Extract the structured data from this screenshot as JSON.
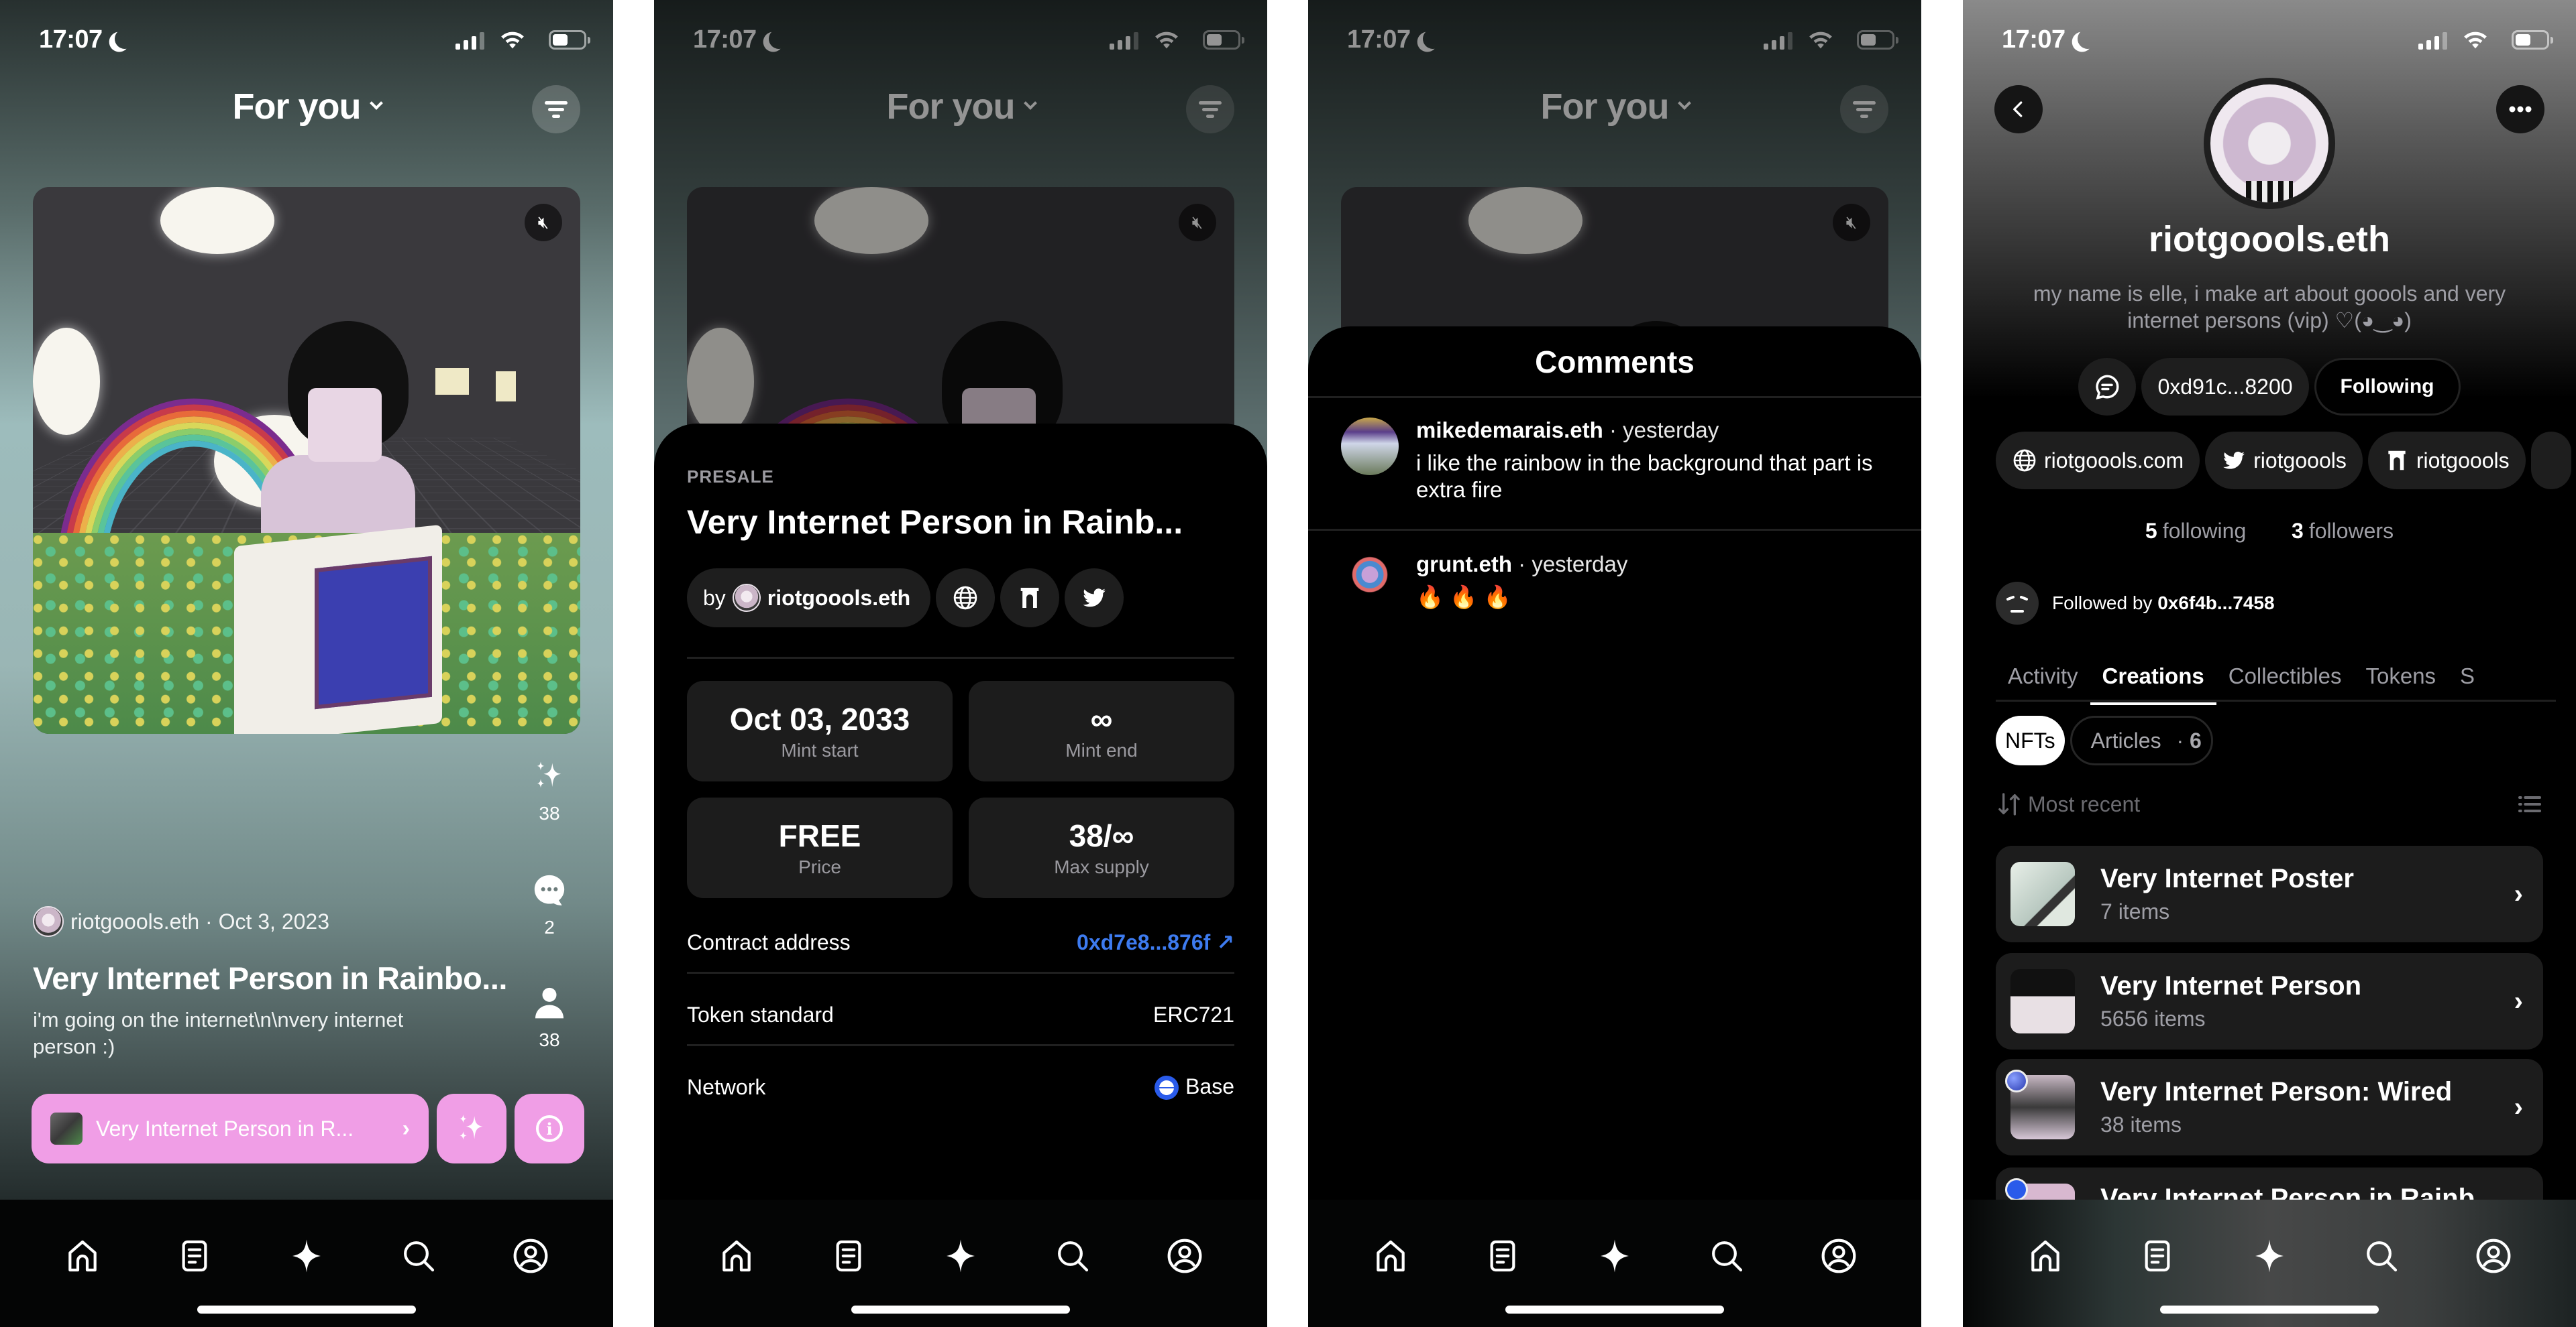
{
  "status_bar": {
    "time": "17:07"
  },
  "feed": {
    "header_title": "For you",
    "post": {
      "author": "riotgoools.eth",
      "date": "Oct 3, 2023",
      "author_line": "riotgoools.eth · Oct 3, 2023",
      "title": "Very Internet Person in Rainbo...",
      "description": "i'm going on the internet\\n\\nvery internet person :)",
      "mint_count": "38",
      "comment_count": "2",
      "collector_count": "38",
      "cta_label": "Very Internet Person in R...",
      "accent_color": "#f09ee6"
    }
  },
  "mint_sheet": {
    "status_label": "PRESALE",
    "title": "Very Internet Person in Rainb...",
    "by_label": "by",
    "creator": "riotgoools.eth",
    "stats": [
      {
        "value": "Oct 03, 2033",
        "label": "Mint start"
      },
      {
        "value": "∞",
        "label": "Mint end"
      },
      {
        "value": "FREE",
        "label": "Price"
      },
      {
        "value": "38/∞",
        "label": "Max supply"
      }
    ],
    "details": [
      {
        "label": "Contract address",
        "value": "0xd7e8...876f ↗"
      },
      {
        "label": "Token standard",
        "value": "ERC721"
      },
      {
        "label": "Network",
        "value": "Base"
      }
    ],
    "link_color": "#3d7bf0"
  },
  "comments_sheet": {
    "title": "Comments",
    "items": [
      {
        "author": "mikedemarais.eth",
        "time": "· yesterday",
        "text": "i like the rainbow in the background that part is extra fire"
      },
      {
        "author": "grunt.eth",
        "time": "· yesterday",
        "text": "🔥 🔥 🔥"
      }
    ]
  },
  "profile": {
    "name": "riotgoools.eth",
    "bio": "my name is elle, i make art about goools and very internet persons (vip) ♡(◕‿◕)",
    "address": "0xd91c...8200",
    "follow_button": "Following",
    "links": [
      {
        "icon": "globe-icon",
        "label": "riotgoools.com"
      },
      {
        "icon": "twitter-icon",
        "label": "riotgoools"
      },
      {
        "icon": "foundation-icon",
        "label": "riotgoools"
      }
    ],
    "following_count": "5",
    "following_label": "following",
    "followers_count": "3",
    "followers_label": "followers",
    "followed_by_prefix": "Followed by",
    "followed_by_address": "0x6f4b...7458",
    "tabs": [
      "Activity",
      "Creations",
      "Collectibles",
      "Tokens",
      "S"
    ],
    "active_tab": "Creations",
    "filters": {
      "nfts": "NFTs",
      "articles": "Articles",
      "articles_count": "6"
    },
    "sort_label": "Most recent",
    "collections": [
      {
        "title": "Very Internet Poster",
        "subtitle": "7 items"
      },
      {
        "title": "Very Internet Person",
        "subtitle": "5656 items"
      },
      {
        "title": "Very Internet Person: Wired",
        "subtitle": "38 items"
      },
      {
        "title": "Very Internet Person in Rainb...",
        "subtitle": ""
      }
    ]
  },
  "nav": {
    "items": [
      "home",
      "articles",
      "mint",
      "search",
      "profile"
    ]
  }
}
